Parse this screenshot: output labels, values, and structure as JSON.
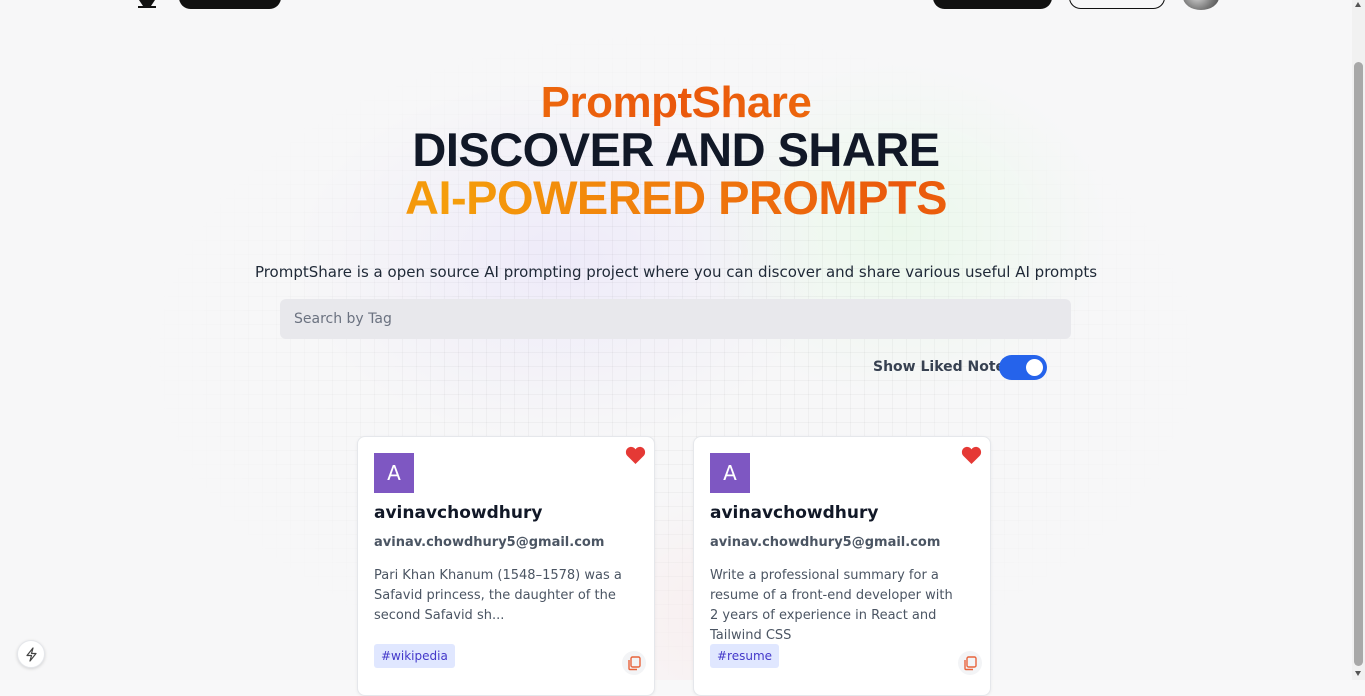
{
  "hero": {
    "brand": "PromptShare",
    "headline_line1": "DISCOVER AND SHARE",
    "headline_line2": "AI-POWERED PROMPTS",
    "description": "PromptShare is a open source AI prompting project where you can discover and share various useful AI prompts"
  },
  "search": {
    "placeholder": "Search by Tag",
    "value": ""
  },
  "liked_toggle": {
    "label": "Show Liked Notes",
    "on": true
  },
  "colors": {
    "accent": "#f59e0b",
    "toggle": "#2563eb",
    "avatar_bg": "#7e57c2",
    "heart": "#e53935",
    "tag_bg": "#e0e7ff"
  },
  "cards": [
    {
      "avatar_letter": "A",
      "username": "avinavchowdhury",
      "email": "avinav.chowdhury5@gmail.com",
      "text": "Pari Khan Khanum (1548–1578) was a Safavid princess, the daughter of the second Safavid sh...",
      "tag": "#wikipedia",
      "icons": [
        "heart-icon",
        "copy-icon"
      ]
    },
    {
      "avatar_letter": "A",
      "username": "avinavchowdhury",
      "email": "avinav.chowdhury5@gmail.com",
      "text": "Write a professional summary for a resume of a front-end developer with 2 years of experience in React and Tailwind CSS",
      "tag": "#resume",
      "icons": [
        "heart-icon",
        "copy-icon"
      ]
    }
  ]
}
